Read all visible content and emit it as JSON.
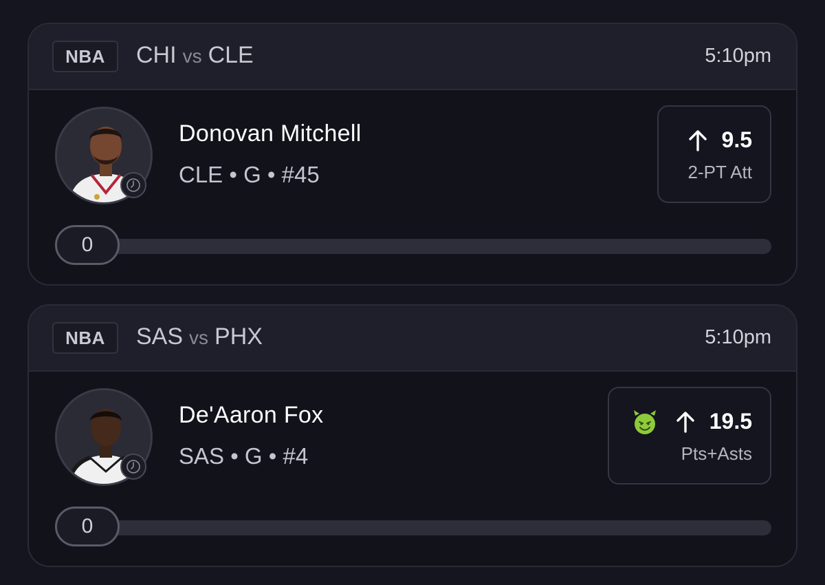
{
  "cards": [
    {
      "league": "NBA",
      "team_a": "CHI",
      "vs": "vs",
      "team_b": "CLE",
      "time": "5:10pm",
      "player": {
        "name": "Donovan Mitchell",
        "meta": "CLE • G • #45",
        "jersey_color": "#f2f2f2",
        "accent_color": "#b3263a"
      },
      "projection": {
        "direction_icon": "arrow-up-icon",
        "line": "9.5",
        "stat": "2-PT Att",
        "special_icon": null
      },
      "progress": {
        "value": "0",
        "fraction": 0
      }
    },
    {
      "league": "NBA",
      "team_a": "SAS",
      "vs": "vs",
      "team_b": "PHX",
      "time": "5:10pm",
      "player": {
        "name": "De'Aaron Fox",
        "meta": "SAS • G • #4",
        "jersey_color": "#f2f2f2",
        "accent_color": "#1a1a1a"
      },
      "projection": {
        "direction_icon": "arrow-up-icon",
        "line": "19.5",
        "stat": "Pts+Asts",
        "special_icon": "green-demon-icon",
        "special_color": "#8ecb3a"
      },
      "progress": {
        "value": "0",
        "fraction": 0
      }
    }
  ]
}
